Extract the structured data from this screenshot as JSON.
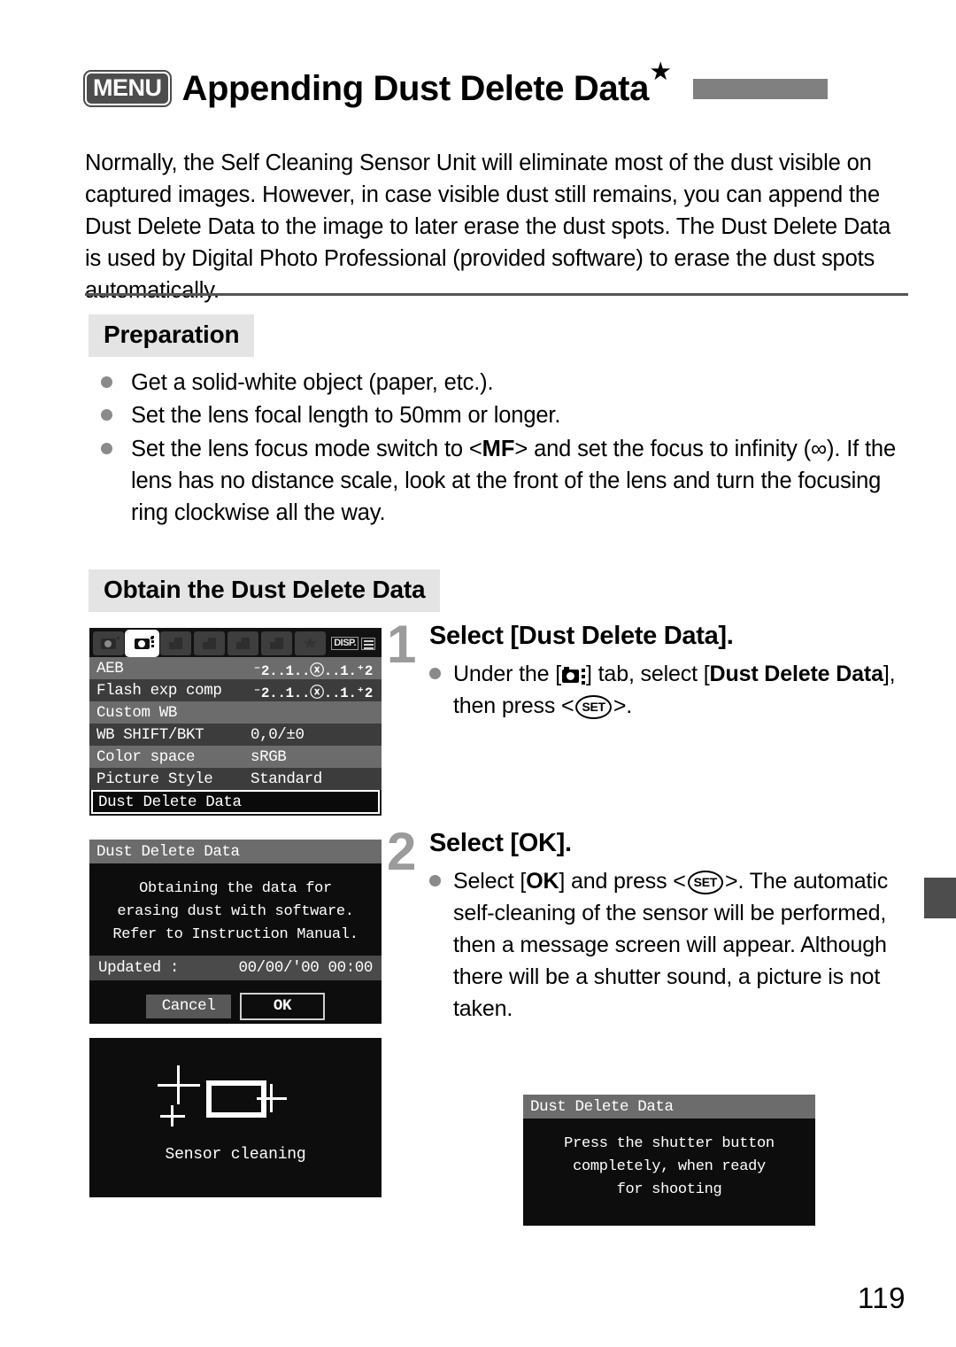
{
  "header": {
    "menu_badge": "MENU",
    "title": "Appending Dust Delete Data",
    "star": "★"
  },
  "intro": "Normally, the Self Cleaning Sensor Unit will eliminate most of the dust visible on captured images. However, in case visible dust still remains, you can append the Dust Delete Data to the image to later erase the dust spots. The Dust Delete Data is used by Digital Photo Professional (provided software) to erase the dust spots automatically.",
  "sections": {
    "preparation_heading": "Preparation",
    "obtain_heading": "Obtain the Dust Delete Data"
  },
  "preparation_items": [
    "Get a solid-white object (paper, etc.).",
    "Set the lens focal length to 50mm or longer.",
    ""
  ],
  "preparation_item3": {
    "part1": "Set the lens focus mode switch to <",
    "mf": "MF",
    "part2": "> and set the focus to infinity (∞). If the lens has no distance scale, look at the front of the lens and turn the focusing ring clockwise all the way."
  },
  "menu_screen": {
    "tabs": [
      {
        "name": "shooting-1",
        "state": "dim"
      },
      {
        "name": "shooting-2",
        "state": "active"
      },
      {
        "name": "playback",
        "state": "dim"
      },
      {
        "name": "setup-1",
        "state": "dim"
      },
      {
        "name": "setup-2",
        "state": "dim"
      },
      {
        "name": "setup-3",
        "state": "dim"
      },
      {
        "name": "my-menu",
        "state": "dim"
      }
    ],
    "disp_label": "DISP.",
    "rows": [
      {
        "label": "AEB",
        "value": "⁻2..1..ⓧ..1.⁺2",
        "scale": true
      },
      {
        "label": "Flash exp comp",
        "value": "⁻2..1..ⓧ..1.⁺2",
        "scale": true
      },
      {
        "label": "Custom WB",
        "value": ""
      },
      {
        "label": "WB SHIFT/BKT",
        "value": "0,0/±0"
      },
      {
        "label": "Color space",
        "value": "sRGB"
      },
      {
        "label": "Picture Style",
        "value": "Standard"
      }
    ],
    "selected_row": "Dust Delete Data"
  },
  "dialog_screen": {
    "title": "Dust Delete Data",
    "line1": "Obtaining the data for",
    "line2": "erasing dust with software.",
    "line3": "Refer to Instruction Manual.",
    "updated_label": "Updated :",
    "updated_value": "00/00/'00 00:00",
    "cancel": "Cancel",
    "ok": "OK"
  },
  "cleaning_screen": {
    "label": "Sensor cleaning"
  },
  "message_screen": {
    "title": "Dust Delete Data",
    "line1": "Press the shutter button",
    "line2": "completely, when ready",
    "line3": "for shooting"
  },
  "steps": [
    {
      "number": "1",
      "heading": "Select [Dust Delete Data].",
      "text_part1": "Under the [",
      "text_part2": "] tab, select [",
      "bold1": "Dust Delete Data",
      "text_part3": "], then press <",
      "set": "SET",
      "text_part4": ">."
    },
    {
      "number": "2",
      "heading": "Select [OK].",
      "text_part1": "Select [",
      "bold1": "OK",
      "text_part2": "] and press <",
      "set": "SET",
      "text_part3": ">. The automatic self-cleaning of the sensor will be performed, then a message screen will appear. Although there will be a shutter sound, a picture is not taken."
    }
  ],
  "page_number": "119",
  "colors": {
    "title_bar": "#808080",
    "section_bg": "#e4e4e4",
    "bullet": "#8a8a8a",
    "step_number": "#9b9b9b",
    "side_tab": "#4d4d4d"
  }
}
